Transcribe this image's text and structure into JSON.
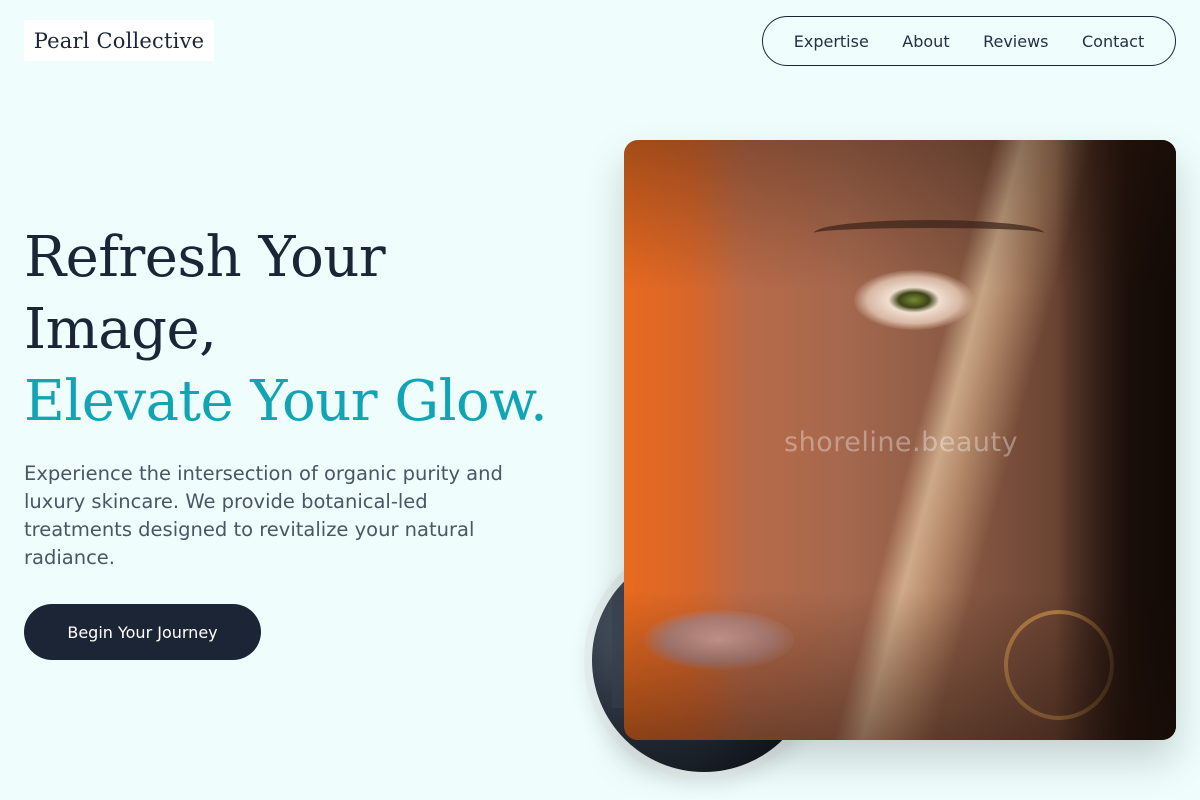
{
  "brand": {
    "name": "Pearl Collective"
  },
  "nav": {
    "items": [
      {
        "label": "Expertise"
      },
      {
        "label": "About"
      },
      {
        "label": "Reviews"
      },
      {
        "label": "Contact"
      }
    ]
  },
  "hero": {
    "headline_line1": "Refresh Your",
    "headline_line2": "Image,",
    "headline_accent": "Elevate Your Glow.",
    "description": "Experience the intersection of organic purity and luxury skincare. We provide botanical-led treatments designed to revitalize your natural radiance.",
    "cta_label": "Begin Your Journey"
  },
  "media": {
    "watermark": "shoreline.beauty"
  },
  "colors": {
    "background": "#effefd",
    "primary_dark": "#1c2536",
    "accent": "#11a4b4",
    "body_text": "#4a5566"
  }
}
